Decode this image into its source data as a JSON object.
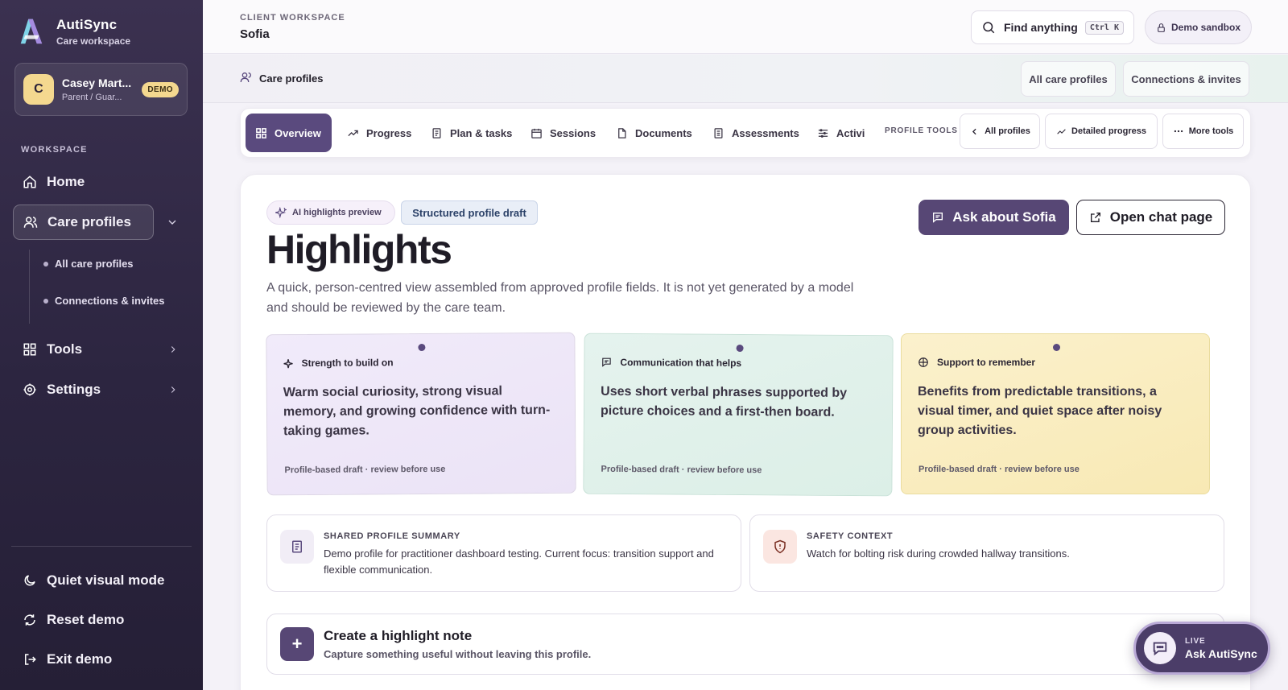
{
  "sidebar": {
    "brand_name": "AutiSync",
    "brand_sub": "Care workspace",
    "user": {
      "initial": "C",
      "name": "Casey Mart...",
      "role": "Parent / Guar...",
      "badge": "DEMO"
    },
    "section_label": "WORKSPACE",
    "nav": {
      "home": "Home",
      "care_profiles": "Care profiles",
      "sub_all": "All care profiles",
      "sub_connections": "Connections & invites",
      "tools": "Tools",
      "settings": "Settings"
    },
    "footer": {
      "quiet": "Quiet visual mode",
      "reset": "Reset demo",
      "exit": "Exit demo"
    }
  },
  "header": {
    "label": "CLIENT WORKSPACE",
    "title": "Sofia",
    "search_label": "Find anything",
    "search_shortcut": "Ctrl K",
    "sandbox": "Demo sandbox"
  },
  "subbar": {
    "title": "Care profiles",
    "btn_all": "All care profiles",
    "btn_connections": "Connections & invites"
  },
  "tabs": {
    "overview": "Overview",
    "progress": "Progress",
    "plan": "Plan & tasks",
    "sessions": "Sessions",
    "documents": "Documents",
    "assessments": "Assessments",
    "activity": "Activi",
    "tools_label": "PROFILE TOOLS",
    "all_profiles": "All profiles",
    "detailed_progress": "Detailed progress",
    "more_tools": "More tools"
  },
  "highlights": {
    "chip_ai": "AI highlights preview",
    "chip_draft": "Structured profile draft",
    "title": "Highlights",
    "description": "A quick, person-centred view assembled from approved profile fields. It is not yet generated by a model and should be reviewed by the care team.",
    "ask_button": "Ask about Sofia",
    "open_chat_button": "Open chat page",
    "cards": [
      {
        "title": "Strength to build on",
        "body": "Warm social curiosity, strong visual memory, and growing confidence with turn-taking games.",
        "footer": "Profile-based draft · review before use"
      },
      {
        "title": "Communication that helps",
        "body": "Uses short verbal phrases supported by picture choices and a first-then board.",
        "footer": "Profile-based draft · review before use"
      },
      {
        "title": "Support to remember",
        "body": "Benefits from predictable transitions, a visual timer, and quiet space after noisy group activities.",
        "footer": "Profile-based draft · review before use"
      }
    ],
    "summary_label": "SHARED PROFILE SUMMARY",
    "summary_body": "Demo profile for practitioner dashboard testing. Current focus: transition support and flexible communication.",
    "safety_label": "SAFETY CONTEXT",
    "safety_body": "Watch for bolting risk during crowded hallway transitions.",
    "note_title": "Create a highlight note",
    "note_sub": "Capture something useful without leaving this profile."
  },
  "live": {
    "label": "LIVE",
    "title": "Ask AutiSync"
  },
  "colors": {
    "sidebar": "#2c2540",
    "accent": "#574775",
    "badge": "#f4d88f"
  }
}
